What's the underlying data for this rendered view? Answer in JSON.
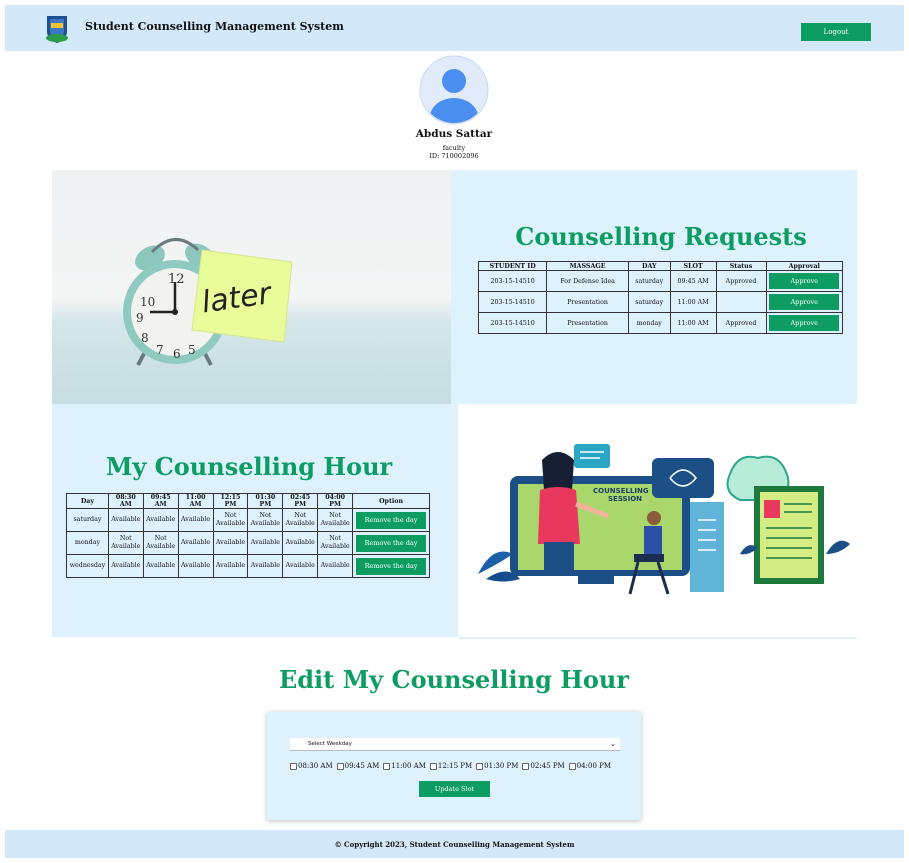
{
  "navbar": {
    "brand": "Student Counselling Management System",
    "logout_label": "Logout"
  },
  "profile": {
    "name": "Abdus Sattar",
    "role": "faculty",
    "id_text": "ID: 710002096"
  },
  "illustration1": {
    "note_text": "later"
  },
  "illustration2": {
    "screen_text_1": "COUNSELLING",
    "screen_text_2": "SESSION"
  },
  "requests": {
    "title": "Counselling Requests",
    "headers": [
      "STUDENT ID",
      "MASSAGE",
      "DAY",
      "SLOT",
      "Status",
      "Approval"
    ],
    "rows": [
      {
        "student_id": "203-15-14510",
        "message": "For Defense Idea",
        "day": "saturday",
        "slot": "09:45 AM",
        "status": "Approved",
        "action": "Approve"
      },
      {
        "student_id": "203-15-14510",
        "message": "Presentation",
        "day": "saturday",
        "slot": "11:00 AM",
        "status": "",
        "action": "Approve"
      },
      {
        "student_id": "203-15-14510",
        "message": "Presentation",
        "day": "monday",
        "slot": "11:00 AM",
        "status": "Approved",
        "action": "Approve"
      }
    ]
  },
  "hours": {
    "title": "My Counselling Hour",
    "headers": [
      "Day",
      "08:30 AM",
      "09:45 AM",
      "11:00 AM",
      "12:15 PM",
      "01:30 PM",
      "02:45 PM",
      "04:00 PM",
      "Option"
    ],
    "rows": [
      {
        "day": "saturday",
        "cells": [
          "Available",
          "Available",
          "Available",
          "Not Available",
          "Not Available",
          "Not Available",
          "Not Available"
        ],
        "action": "Remove the day"
      },
      {
        "day": "monday",
        "cells": [
          "Not Available",
          "Not Available",
          "Available",
          "Available",
          "Available",
          "Available",
          "Not Available"
        ],
        "action": "Remove the day"
      },
      {
        "day": "wednesday",
        "cells": [
          "Available",
          "Available",
          "Available",
          "Available",
          "Available",
          "Available",
          "Available"
        ],
        "action": "Remove the day"
      }
    ]
  },
  "edit": {
    "title": "Edit My Counselling Hour",
    "select_value": "Select Weekday",
    "slots": [
      "08:30 AM",
      "09:45 AM",
      "11:00 AM",
      "12:15 PM",
      "01:30 PM",
      "02:45 PM",
      "04:00 PM"
    ],
    "update_label": "Update Slot"
  },
  "footer": {
    "text": "© Copyright 2023, Student Counselling Management System"
  },
  "colors": {
    "accent": "#0d9d62",
    "nav_bg": "#d3e8f8",
    "panel_bg": "#ddf2fc"
  }
}
